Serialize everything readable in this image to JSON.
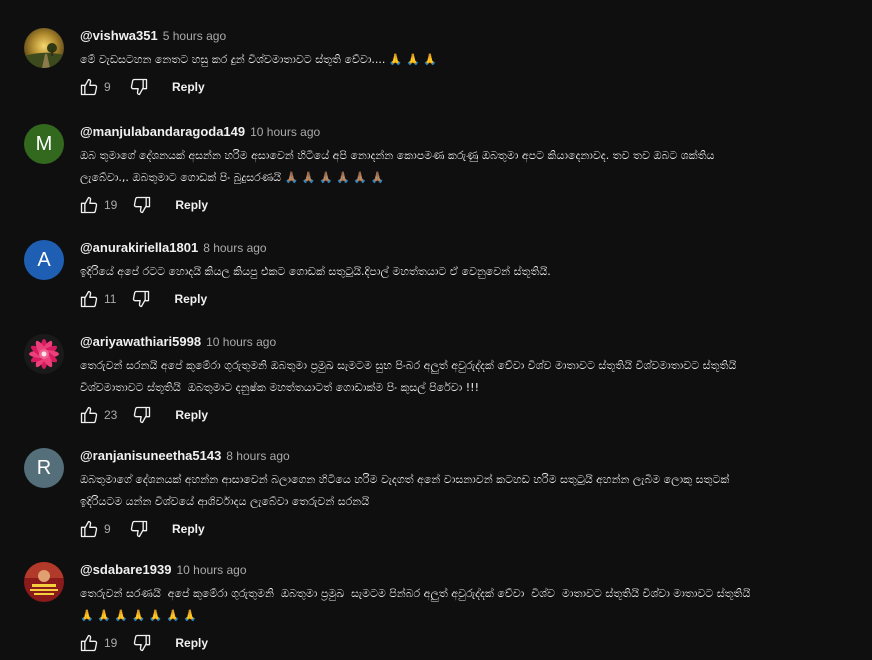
{
  "comments": [
    {
      "handle": "@vishwa351",
      "time": "5 hours ago",
      "text": "මේ වැඩසටහන නෙතට හසු කර දුන් විශ්වමාතාවට ස්තූති වේවා.... 🙏 🙏 🙏",
      "likes": "9",
      "reply": "Reply",
      "avatar_letter": "",
      "avatar_color": "#6b5a2a"
    },
    {
      "handle": "@manjulabandaragoda149",
      "time": "10 hours ago",
      "text": "ඔබ තුමාගේ දේශනයක් අසන්න හරිම අසාවෙන් හිටියේ අපි නොදන්න කොපමණ කරුණු ඔබතුමා අපට කියාදෙනාවද. තව තව ඔබට ශක්තිය\nලැබේවා.,. ඔබතුමාට ගොඩක් පිං බුදුසරණයි 🙏🏽 🙏🏽 🙏🏽 🙏🏽 🙏🏽 🙏🏽",
      "likes": "19",
      "reply": "Reply",
      "avatar_letter": "M",
      "avatar_color": "#33691e"
    },
    {
      "handle": "@anurakiriella1801",
      "time": "8 hours ago",
      "text": "ඉදිරියේ අපේ රටට හොදයි කියල කියපු එකට ගොඩක් සතුටුයි.දිපාල් මහත්තයාට ඒ වෙනුවෙන් ස්තූතියි.",
      "likes": "11",
      "reply": "Reply",
      "avatar_letter": "A",
      "avatar_color": "#1e5fb4"
    },
    {
      "handle": "@ariyawathiari5998",
      "time": "10 hours ago",
      "text": "තෙරුවන් සරනයි අපේ කුමේරා ගුරුතුමනි ඔබතුමා ප්‍රමුඛ සැමටම සුභ පිංබර අලුත් අවුරුද්දක් වේවා විශ්ව මාතාවට ස්තූතියි විශ්වමාතාවට ස්තූතියි\nවිශ්වමාතාවට ස්තූතියි  ඔබතුමාට දනුෂ්ක මහත්තයාටත් ගොඩාක්ම පිං කුසල් පිරේවා !!!",
      "likes": "23",
      "reply": "Reply",
      "avatar_letter": "",
      "avatar_color": "#c2185b"
    },
    {
      "handle": "@ranjanisuneetha5143",
      "time": "8 hours ago",
      "text": "ඔබතුමාගේ දේශනයක් අහන්න ආසාවෙන් බලාගෙන හිටියෙ හරිම වැදගත් අනේ වාසනාවන් කටහඩ හරිම සතුටුයි අහන්න ලැබීම ලොකු සතුටක්\nඉදිරියටම යන්න විශ්වයේ ආශිර්වාදය ලැබේවා තෙරුවන් සරනයි",
      "likes": "9",
      "reply": "Reply",
      "avatar_letter": "R",
      "avatar_color": "#546e7a"
    },
    {
      "handle": "@sdabare1939",
      "time": "10 hours ago",
      "text": "තෙරුවන් සරණයි  අපේ කුමේරා ගුරුතුමනි  ඔබතුමා ප්‍රමුඛ  සැමටම පින්බර අලුත් අවුරුද්දක් වේවා  විශ්ව  මාතාවට ස්තූතියි විශ්වා මාතාවට ස්තූතියි\n🙏 🙏 🙏 🙏 🙏 🙏 🙏",
      "likes": "19",
      "reply": "Reply",
      "avatar_letter": "",
      "avatar_color": "#8b1a1a"
    }
  ]
}
